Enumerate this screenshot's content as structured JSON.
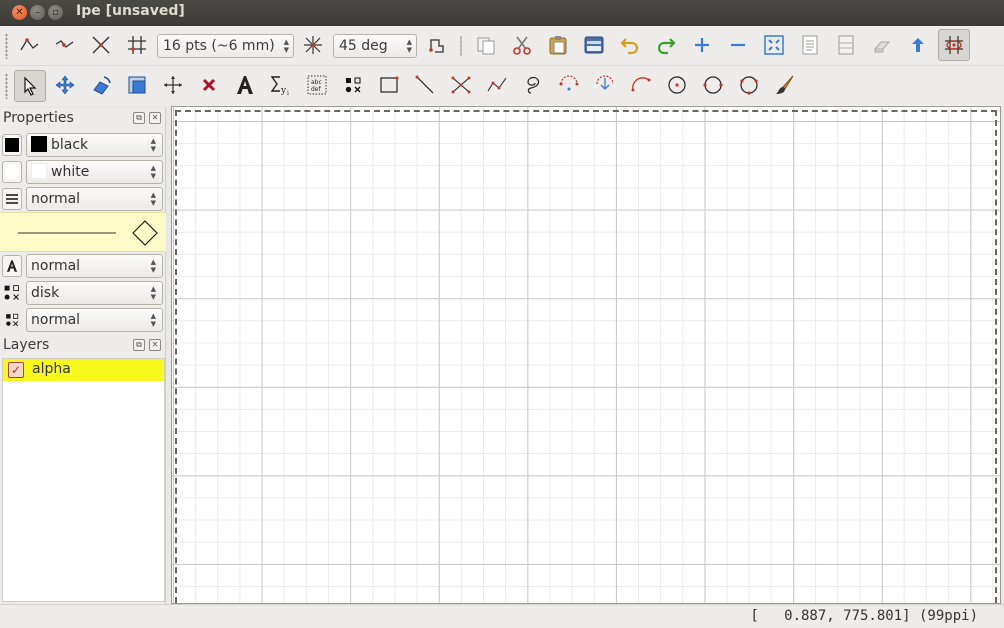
{
  "window": {
    "title": "Ipe [unsaved]"
  },
  "toolbar": {
    "grid_size": "16 pts (~6 mm)",
    "angle": "45 deg",
    "snap_tools": [
      "snap-vertex-icon",
      "snap-boundary-icon",
      "snap-intersection-icon",
      "snap-grid-icon"
    ],
    "edit_tools": [
      "copy-icon",
      "cut-icon",
      "paste-icon",
      "page-view-icon",
      "undo-icon",
      "redo-icon",
      "zoom-in-icon",
      "zoom-out-icon",
      "fit-page-icon",
      "page-list-icon",
      "page-properties-icon",
      "eraser-icon",
      "up-arrow-icon",
      "grid-toggle-icon"
    ]
  },
  "modes": [
    "select-icon",
    "translate-icon",
    "rotate-icon",
    "stretch-icon",
    "pan-icon",
    "shred-icon",
    "text-icon",
    "formula-icon",
    "paragraph-icon",
    "marks-icon",
    "rectangle-icon",
    "line-icon",
    "splinegon-icon",
    "polyline-icon",
    "lasso-icon",
    "arc1-icon",
    "arc2-icon",
    "arc3-icon",
    "circle-icon",
    "circle-diameter-icon",
    "circle-3pt-icon",
    "ink-icon"
  ],
  "properties": {
    "title": "Properties",
    "stroke": "black",
    "fill": "white",
    "pen": "normal",
    "text_size": "normal",
    "mark_shape": "disk",
    "mark_size": "normal",
    "colors": {
      "stroke": "#000000",
      "fill": "#ffffff",
      "preview_bg": "#fdfbc8"
    }
  },
  "layers": {
    "title": "Layers",
    "items": [
      {
        "label": "alpha",
        "checked": true,
        "highlight": "#f8f81c"
      }
    ]
  },
  "status": {
    "text": "[   0.887, 775.801] (99ppi)"
  }
}
